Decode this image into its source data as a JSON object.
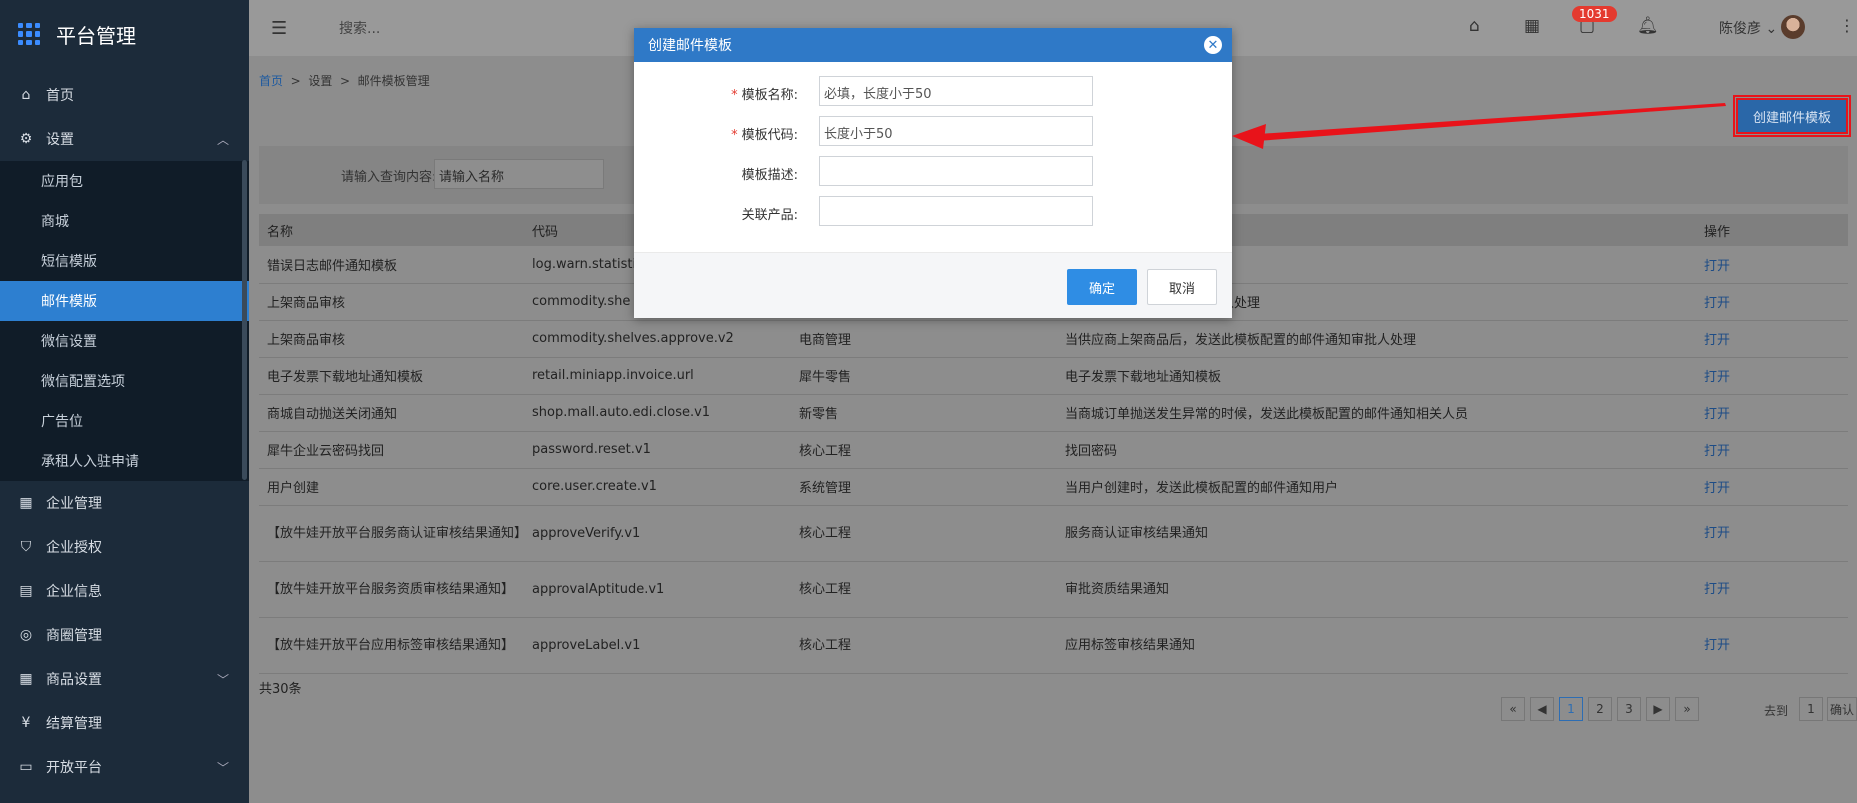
{
  "sidebar": {
    "title": "平台管理",
    "items_top": [
      {
        "label": "首页",
        "icon": "home-icon"
      },
      {
        "label": "设置",
        "icon": "gear-icon"
      }
    ],
    "sub_items": [
      "应用包",
      "商城",
      "短信模版",
      "邮件模版",
      "微信设置",
      "微信配置选项",
      "广告位",
      "承租人入驻申请"
    ],
    "items_bottom": [
      {
        "label": "企业管理",
        "icon": "building-icon"
      },
      {
        "label": "企业授权",
        "icon": "shield-icon"
      },
      {
        "label": "企业信息",
        "icon": "card-icon"
      },
      {
        "label": "商圈管理",
        "icon": "compass-icon"
      },
      {
        "label": "商品设置",
        "icon": "grid-icon"
      },
      {
        "label": "结算管理",
        "icon": "currency-icon"
      },
      {
        "label": "开放平台",
        "icon": "open-icon"
      }
    ]
  },
  "topbar": {
    "search_placeholder": "搜索...",
    "badge": "1031",
    "user": "陈俊彦"
  },
  "breadcrumb": [
    "首页",
    "设置",
    "邮件模板管理"
  ],
  "create_button": "创建邮件模板",
  "filter": {
    "label": "请输入查询内容:",
    "placeholder": "请输入名称"
  },
  "table": {
    "headers": [
      "名称",
      "代码",
      "",
      "",
      "操作"
    ],
    "rows": [
      [
        "错误日志邮件通知模板",
        "log.warn.statisti",
        "",
        "",
        "打开"
      ],
      [
        "上架商品审核",
        "commodity.she",
        "",
        "此模板配置的邮件通知审批人处理",
        "打开"
      ],
      [
        "上架商品审核",
        "commodity.shelves.approve.v2",
        "电商管理",
        "当供应商上架商品后，发送此模板配置的邮件通知审批人处理",
        "打开"
      ],
      [
        "电子发票下载地址通知模板",
        "retail.miniapp.invoice.url",
        "犀牛零售",
        "电子发票下载地址通知模板",
        "打开"
      ],
      [
        "商城自动抛送关闭通知",
        "shop.mall.auto.edi.close.v1",
        "新零售",
        "当商城订单抛送发生异常的时候，发送此模板配置的邮件通知相关人员",
        "打开"
      ],
      [
        "犀牛企业云密码找回",
        "password.reset.v1",
        "核心工程",
        "找回密码",
        "打开"
      ],
      [
        "用户创建",
        "core.user.create.v1",
        "系统管理",
        "当用户创建时，发送此模板配置的邮件通知用户",
        "打开"
      ],
      [
        "【放牛娃开放平台服务商认证审核结果通知】",
        "approveVerify.v1",
        "核心工程",
        "服务商认证审核结果通知",
        "打开"
      ],
      [
        "【放牛娃开放平台服务资质审核结果通知】",
        "approvalAptitude.v1",
        "核心工程",
        "审批资质结果通知",
        "打开"
      ],
      [
        "【放牛娃开放平台应用标签审核结果通知】",
        "approveLabel.v1",
        "核心工程",
        "应用标签审核结果通知",
        "打开"
      ]
    ]
  },
  "total": "共30条",
  "pager": {
    "pages": [
      "1",
      "2",
      "3"
    ],
    "first": "«",
    "prev": "◀",
    "next": "▶",
    "last": "»",
    "goto_label": "去到",
    "goto_value": "1",
    "confirm": "确认"
  },
  "modal": {
    "title": "创建邮件模板",
    "fields": [
      {
        "label": "模板名称:",
        "required": true,
        "placeholder": "必填，长度小于50"
      },
      {
        "label": "模板代码:",
        "required": true,
        "placeholder": "长度小于50"
      },
      {
        "label": "模板描述:",
        "required": false,
        "placeholder": ""
      },
      {
        "label": "关联产品:",
        "required": false,
        "placeholder": ""
      }
    ],
    "ok": "确定",
    "cancel": "取消"
  },
  "colors": {
    "sidebar_bg": "#1c2b3a",
    "active": "#2d7fd0",
    "modal_head": "#2f79c7",
    "annotation": "#e8131a"
  }
}
